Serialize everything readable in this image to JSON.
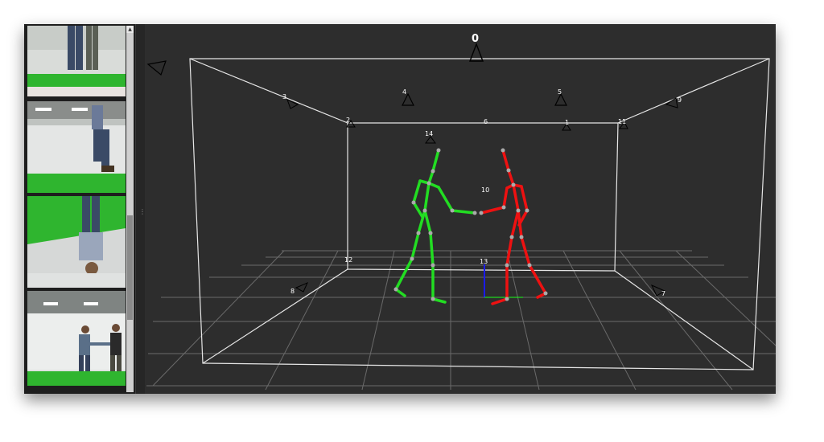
{
  "sidebar": {
    "scroll_up_glyph": "▲",
    "grip_glyph": "⋮",
    "thumbnails": [
      {
        "name": "camera-thumbnail-feet"
      },
      {
        "name": "camera-thumbnail-overhead-walk"
      },
      {
        "name": "camera-thumbnail-upside-down"
      },
      {
        "name": "camera-thumbnail-handshake"
      },
      {
        "name": "camera-thumbnail-partial"
      }
    ]
  },
  "viewport": {
    "colors": {
      "background": "#2d2d2d",
      "grid": "#6a6a6a",
      "volume_box": "#e6e6e6",
      "skeleton_a": "#22dd22",
      "skeleton_b": "#ee1111",
      "joint": "#aaaaaa",
      "axis_z": "#1a1aff"
    },
    "cameras": [
      {
        "label": "0",
        "icon": "camera-pyramid-icon"
      },
      {
        "label": "1",
        "icon": "camera-pyramid-icon"
      },
      {
        "label": "2",
        "icon": "camera-pyramid-icon"
      },
      {
        "label": "3",
        "icon": "camera-pyramid-icon"
      },
      {
        "label": "4",
        "icon": "camera-pyramid-icon"
      },
      {
        "label": "5",
        "icon": "camera-pyramid-icon"
      },
      {
        "label": "6",
        "icon": "camera-pyramid-icon"
      },
      {
        "label": "7",
        "icon": "camera-pyramid-icon"
      },
      {
        "label": "8",
        "icon": "camera-pyramid-icon"
      },
      {
        "label": "9",
        "icon": "camera-pyramid-icon"
      },
      {
        "label": "10",
        "icon": "camera-pyramid-icon"
      },
      {
        "label": "11",
        "icon": "camera-pyramid-icon"
      },
      {
        "label": "12",
        "icon": "camera-pyramid-icon"
      },
      {
        "label": "13",
        "icon": "camera-pyramid-icon"
      },
      {
        "label": "14",
        "icon": "camera-pyramid-icon"
      }
    ]
  }
}
